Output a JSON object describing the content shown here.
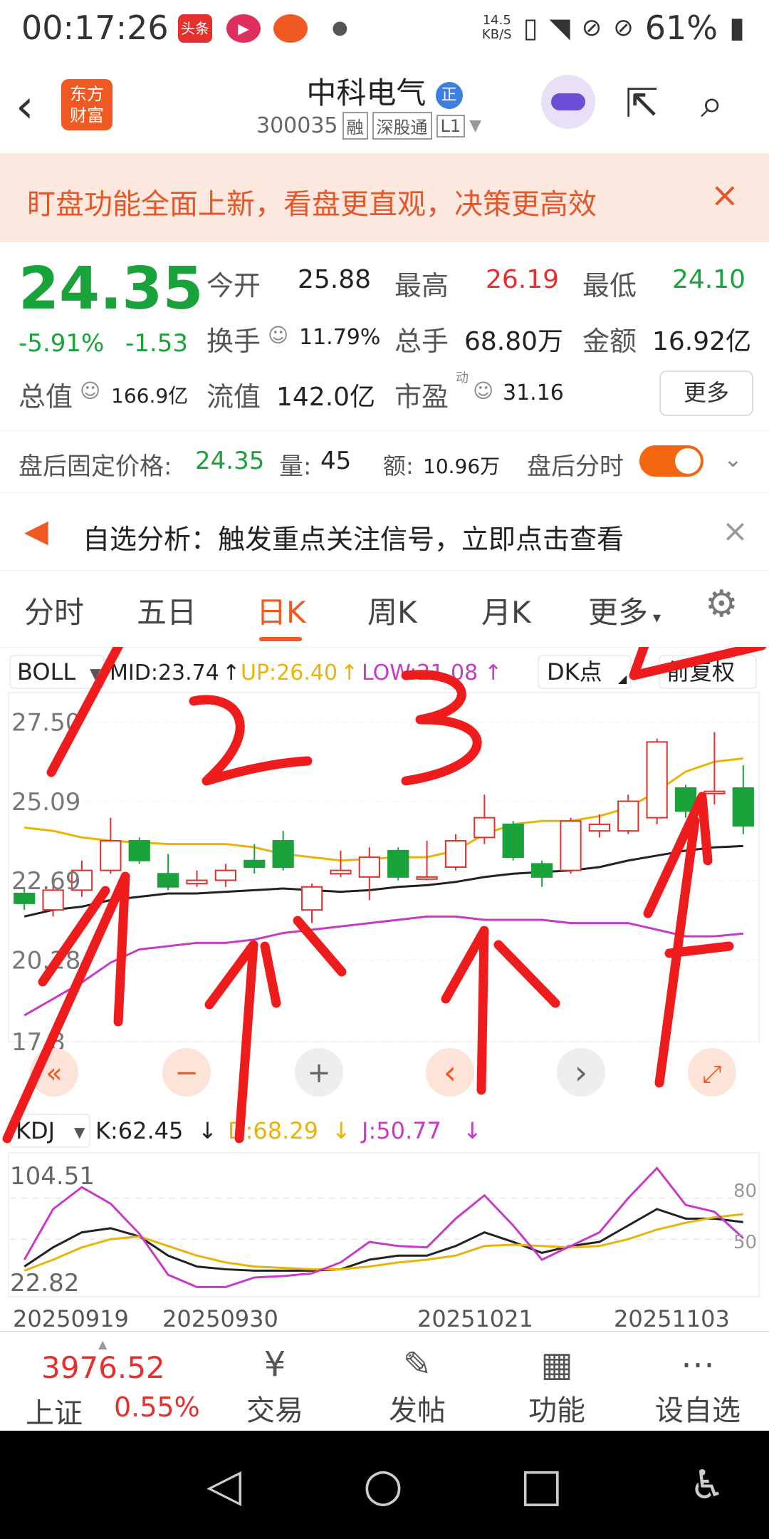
{
  "status_bar": {
    "time": "00:17:26",
    "net_speed": "14.5",
    "net_unit": "KB/S",
    "battery": "61%",
    "badge1": "头条",
    "badge2": "▶"
  },
  "header": {
    "back_icon": "‹",
    "logo_line1": "东方",
    "logo_line2": "财富",
    "stock_name": "中科电气",
    "verified": "正",
    "code": "300035",
    "tag_rong": "融",
    "tag_sgt": "深股通",
    "tag_level": "L1"
  },
  "banner": {
    "text": "盯盘功能全面上新，看盘更直观，决策更高效",
    "close": "×"
  },
  "quote": {
    "price": "24.35",
    "pct": "-5.91%",
    "chg": "-1.53",
    "open_label": "今开",
    "open": "25.88",
    "high_label": "最高",
    "high": "26.19",
    "low_label": "最低",
    "low": "24.10",
    "turnover_label": "换手",
    "turnover": "11.79%",
    "volume_label": "总手",
    "volume": "68.80万",
    "amount_label": "金额",
    "amount": "16.92亿",
    "mktcap_label": "总值",
    "mktcap": "166.9亿",
    "float_label": "流值",
    "float": "142.0亿",
    "pe_label": "市盈",
    "pe_sup": "动",
    "pe": "31.16",
    "more": "更多"
  },
  "after_hours": {
    "fixed_label": "盘后固定价格:",
    "fixed": "24.35",
    "vol_label": "量:",
    "vol": "45",
    "amt_label": "额:",
    "amt": "10.96万",
    "switch_label": "盘后分时"
  },
  "analysis": {
    "text": "自选分析：触发重点关注信号，立即点击查看",
    "close": "×"
  },
  "tabs": [
    {
      "label": "分时"
    },
    {
      "label": "五日"
    },
    {
      "label": "日K"
    },
    {
      "label": "周K"
    },
    {
      "label": "月K"
    },
    {
      "label": "更多"
    }
  ],
  "indicator": {
    "name": "BOLL",
    "mid": "MID:23.74",
    "up": "UP:26.40",
    "low": "LOW:21.08",
    "dk": "DK点",
    "fq": "前复权",
    "mid_color": "#222222",
    "up_color": "#e8b40a",
    "low_color": "#c63bc6"
  },
  "price_axis": [
    "27.50",
    "25.09",
    "22.69",
    "20.28",
    "17.8"
  ],
  "chart_controls": {
    "back": "«",
    "minus": "−",
    "plus": "+",
    "left": "‹",
    "right": "›",
    "expand": "⤢"
  },
  "kdj": {
    "name": "KDJ",
    "k": "K:62.45",
    "d": "D:68.29",
    "j": "J:50.77",
    "top": "104.51",
    "bottom": "22.82",
    "ref80": "80",
    "ref50": "50"
  },
  "dates": [
    "20250919",
    "20250930",
    "20251021",
    "20251103"
  ],
  "annotations": [
    "1",
    "2",
    "3",
    "4"
  ],
  "bottom_nav": {
    "index_value": "3976.52",
    "index_name": "上证",
    "index_pct": "0.55%",
    "items": [
      {
        "label": "交易",
        "icon": "¥"
      },
      {
        "label": "发帖",
        "icon": "✎"
      },
      {
        "label": "功能",
        "icon": "▦"
      },
      {
        "label": "设自选",
        "icon": "⋯"
      }
    ]
  },
  "colors": {
    "up": "#e5302d",
    "down": "#1aa33a",
    "accent": "#f05a22"
  },
  "chart_data": {
    "type": "candlestick",
    "ylim": [
      17.8,
      28.4
    ],
    "candles": [
      {
        "o": 22.3,
        "c": 22.0,
        "h": 22.5,
        "l": 21.8
      },
      {
        "o": 21.8,
        "c": 22.4,
        "h": 22.6,
        "l": 21.6
      },
      {
        "o": 22.4,
        "c": 23.0,
        "h": 23.3,
        "l": 22.2
      },
      {
        "o": 23.0,
        "c": 23.9,
        "h": 24.6,
        "l": 22.9
      },
      {
        "o": 23.9,
        "c": 23.3,
        "h": 24.0,
        "l": 23.2
      },
      {
        "o": 22.9,
        "c": 22.5,
        "h": 23.5,
        "l": 22.4
      },
      {
        "o": 22.6,
        "c": 22.7,
        "h": 23.0,
        "l": 22.5
      },
      {
        "o": 22.7,
        "c": 23.0,
        "h": 23.2,
        "l": 22.5
      },
      {
        "o": 23.3,
        "c": 23.1,
        "h": 23.8,
        "l": 22.9
      },
      {
        "o": 23.9,
        "c": 23.1,
        "h": 24.2,
        "l": 23.0
      },
      {
        "o": 21.8,
        "c": 22.5,
        "h": 22.6,
        "l": 21.4
      },
      {
        "o": 22.9,
        "c": 23.0,
        "h": 23.6,
        "l": 22.8
      },
      {
        "o": 22.8,
        "c": 23.4,
        "h": 23.7,
        "l": 22.1
      },
      {
        "o": 23.6,
        "c": 22.8,
        "h": 23.7,
        "l": 22.7
      },
      {
        "o": 22.8,
        "c": 22.8,
        "h": 23.9,
        "l": 22.7
      },
      {
        "o": 23.1,
        "c": 23.9,
        "h": 24.1,
        "l": 23.0
      },
      {
        "o": 24.0,
        "c": 24.6,
        "h": 25.3,
        "l": 23.8
      },
      {
        "o": 24.4,
        "c": 23.4,
        "h": 24.5,
        "l": 23.3
      },
      {
        "o": 23.2,
        "c": 22.8,
        "h": 23.3,
        "l": 22.5
      },
      {
        "o": 23.0,
        "c": 24.5,
        "h": 24.6,
        "l": 22.9
      },
      {
        "o": 24.2,
        "c": 24.4,
        "h": 24.7,
        "l": 24.0
      },
      {
        "o": 24.2,
        "c": 25.1,
        "h": 25.3,
        "l": 24.1
      },
      {
        "o": 24.6,
        "c": 26.9,
        "h": 27.0,
        "l": 24.4
      },
      {
        "o": 25.5,
        "c": 24.8,
        "h": 25.6,
        "l": 24.6
      },
      {
        "o": 25.4,
        "c": 25.4,
        "h": 27.2,
        "l": 25.0
      },
      {
        "o": 25.5,
        "c": 24.35,
        "h": 26.19,
        "l": 24.1
      }
    ],
    "series": [
      {
        "name": "MID",
        "values": [
          21.6,
          21.8,
          21.9,
          22.1,
          22.2,
          22.3,
          22.3,
          22.35,
          22.4,
          22.45,
          22.4,
          22.35,
          22.4,
          22.5,
          22.55,
          22.65,
          22.8,
          22.9,
          22.95,
          23.0,
          23.1,
          23.3,
          23.45,
          23.6,
          23.7,
          23.74
        ]
      },
      {
        "name": "UP",
        "values": [
          24.3,
          24.2,
          24.0,
          23.9,
          23.85,
          23.8,
          23.8,
          23.8,
          23.7,
          23.5,
          23.4,
          23.3,
          23.35,
          23.4,
          23.4,
          23.6,
          24.1,
          24.4,
          24.5,
          24.5,
          24.65,
          24.9,
          25.4,
          26.0,
          26.3,
          26.4
        ]
      },
      {
        "name": "LOW",
        "values": [
          18.6,
          19.1,
          19.6,
          20.2,
          20.6,
          20.7,
          20.8,
          20.8,
          20.9,
          21.1,
          21.2,
          21.3,
          21.4,
          21.5,
          21.6,
          21.6,
          21.5,
          21.5,
          21.5,
          21.4,
          21.4,
          21.4,
          21.2,
          21.0,
          21.0,
          21.08
        ]
      }
    ],
    "kdj": {
      "ylim": [
        10,
        110
      ],
      "K": [
        30,
        44,
        55,
        58,
        52,
        38,
        30,
        28,
        27,
        27,
        27,
        28,
        35,
        38,
        38,
        45,
        55,
        48,
        40,
        45,
        48,
        60,
        72,
        65,
        65,
        62.45
      ],
      "D": [
        27,
        35,
        44,
        50,
        52,
        45,
        38,
        33,
        30,
        29,
        28,
        28,
        30,
        33,
        35,
        38,
        45,
        46,
        45,
        44,
        45,
        50,
        57,
        62,
        66,
        68.29
      ],
      "J": [
        35,
        72,
        88,
        76,
        54,
        24,
        15,
        15,
        22,
        23,
        25,
        33,
        48,
        45,
        44,
        65,
        82,
        60,
        35,
        45,
        55,
        80,
        102,
        75,
        70,
        50.77
      ]
    }
  }
}
